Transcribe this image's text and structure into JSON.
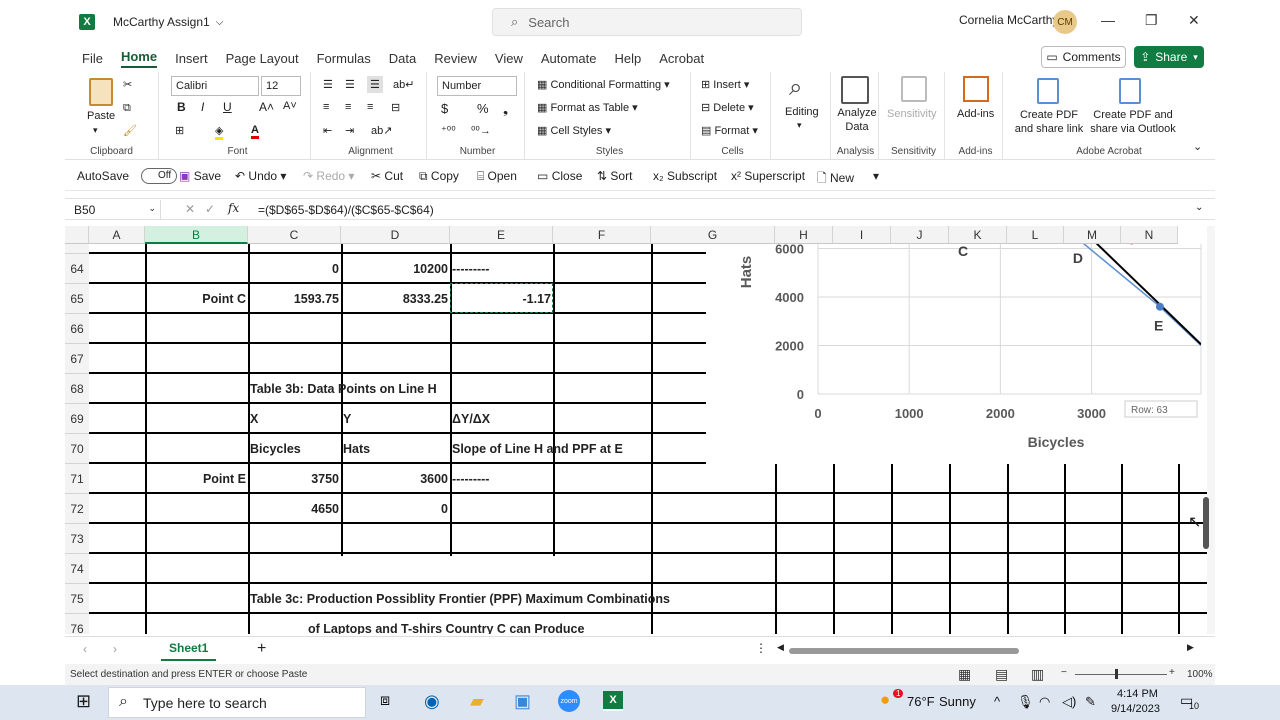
{
  "window": {
    "title": "McCarthy Assign1",
    "search_placeholder": "Search",
    "user_name": "Cornelia McCarthy",
    "user_initials": "CM"
  },
  "menu": {
    "items": [
      "File",
      "Home",
      "Insert",
      "Page Layout",
      "Formulas",
      "Data",
      "Review",
      "View",
      "Automate",
      "Help",
      "Acrobat"
    ],
    "active": "Home",
    "comments": "Comments",
    "share": "Share"
  },
  "ribbon": {
    "paste": "Paste",
    "clipboard": "Clipboard",
    "font_name": "Calibri",
    "font_size": "12",
    "font": "Font",
    "alignment": "Alignment",
    "number_format": "Number",
    "number": "Number",
    "cond_format": "Conditional Formatting",
    "format_table": "Format as Table",
    "cell_styles": "Cell Styles",
    "styles": "Styles",
    "insert": "Insert",
    "delete": "Delete",
    "format": "Format",
    "cells": "Cells",
    "editing": "Editing",
    "analyze_data": "Analyze Data",
    "analysis": "Analysis",
    "sensitivity": "Sensitivity",
    "sensitivity_group": "Sensitivity",
    "addins": "Add-ins",
    "addins_group": "Add-ins",
    "pdf_link": "Create PDF and share link",
    "pdf_outlook": "Create PDF and share via Outlook",
    "adobe": "Adobe Acrobat"
  },
  "qat": {
    "autosave": "AutoSave",
    "autosave_state": "Off",
    "save": "Save",
    "undo": "Undo",
    "redo": "Redo",
    "cut": "Cut",
    "copy": "Copy",
    "open": "Open",
    "close": "Close",
    "sort": "Sort",
    "subscript": "Subscript",
    "superscript": "Superscript",
    "new": "New"
  },
  "formula_bar": {
    "name_box": "B50",
    "formula": "=($D$65-$D$64)/($C$65-$C$64)"
  },
  "columns": [
    "A",
    "B",
    "C",
    "D",
    "E",
    "F",
    "G",
    "H",
    "I",
    "J",
    "K",
    "L",
    "M",
    "N"
  ],
  "rows": [
    "64",
    "65",
    "66",
    "67",
    "68",
    "69",
    "70",
    "71",
    "72",
    "73",
    "74",
    "75",
    "76"
  ],
  "cells": {
    "r64": {
      "C": "0",
      "D": "10200",
      "E": "---------"
    },
    "r65": {
      "B": "Point C",
      "C": "1593.75",
      "D": "8333.25",
      "E": "-1.17"
    },
    "r68": {
      "C": "Table 3b: Data Points on Line H"
    },
    "r69": {
      "C": "X",
      "D": "Y",
      "E": "ΔY/ΔX"
    },
    "r70": {
      "C": "Bicycles",
      "D": "Hats",
      "E": "Slope of Line H and PPF at E"
    },
    "r71": {
      "B": "Point E",
      "C": "3750",
      "D": "3600",
      "E": "---------"
    },
    "r72": {
      "C": "4650",
      "D": "0"
    },
    "r75": {
      "C": "Table 3c: Production Possiblity Frontier (PPF) Maximum Combinations"
    },
    "r76": {
      "C": "of Laptops and T-shirs Country C can Produce"
    }
  },
  "chart_data": {
    "type": "line",
    "xlabel": "Bicycles",
    "ylabel": "Hats",
    "x_ticks": [
      "0",
      "1000",
      "2000",
      "3000"
    ],
    "y_ticks": [
      "0",
      "2000",
      "4000",
      "6000"
    ],
    "xlim": [
      0,
      4200
    ],
    "ylim": [
      0,
      6600
    ],
    "points": [
      {
        "label": "C",
        "x": 1590,
        "y": 8330
      },
      {
        "label": "D",
        "x": 2850,
        "y": 6400
      },
      {
        "label": "E",
        "x": 3750,
        "y": 3600
      }
    ],
    "ppf": {
      "x": [
        1800,
        2850,
        3750,
        4200
      ],
      "y": [
        7800,
        6400,
        3600,
        2000
      ],
      "color": "#5b8fd3"
    },
    "tangent_d": {
      "x": [
        2850,
        3450
      ],
      "y": [
        6750,
        6200
      ],
      "color": "#d42020"
    },
    "line_h": {
      "x": [
        2700,
        4200
      ],
      "y": [
        7500,
        2050
      ],
      "color": "#000000"
    },
    "tooltip": "Row: 63"
  },
  "sheet_tab": "Sheet1",
  "status": {
    "message": "Select destination and press ENTER or choose Paste",
    "zoom": "100%"
  },
  "taskbar": {
    "search_placeholder": "Type here to search",
    "weather_temp": "76°F",
    "weather_desc": "Sunny",
    "time": "4:14 PM",
    "date": "9/14/2023",
    "notif_count": "10",
    "weather_badge": "1"
  }
}
